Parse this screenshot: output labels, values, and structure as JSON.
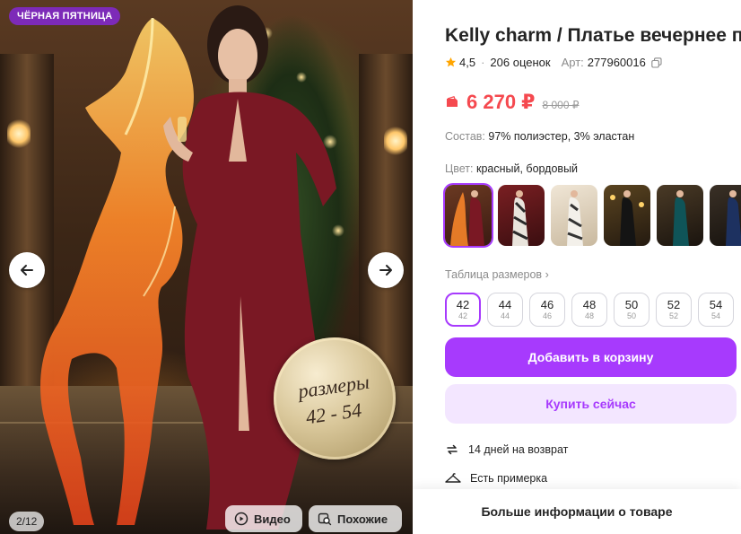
{
  "gallery": {
    "sale_badge": "ЧЁРНАЯ ПЯТНИЦА",
    "seal_line1": "размеры",
    "seal_line2": "42 - 54",
    "counter": "2/12",
    "video_label": "Видео",
    "similar_label": "Похожие",
    "prev_icon": "arrow-left-icon",
    "next_icon": "arrow-right-icon"
  },
  "product": {
    "title": "Kelly charm / Платье вечернее п",
    "rating": "4,5",
    "reviews": "206 оценок",
    "article_label": "Арт:",
    "article": "277960016",
    "price": "6 270 ₽",
    "old_price": "8 000 ₽",
    "composition_label": "Состав:",
    "composition": "97% полиэстер, 3% эластан",
    "color_label": "Цвет:",
    "color": "красный, бордовый"
  },
  "colors": [
    {
      "name": "thumb-1",
      "bg": "#5a1a1a"
    },
    {
      "name": "thumb-2",
      "bg": "#7a1f22"
    },
    {
      "name": "thumb-3",
      "bg": "#d9cbb5"
    },
    {
      "name": "thumb-4",
      "bg": "#2a2420"
    },
    {
      "name": "thumb-5",
      "bg": "#123c3e"
    },
    {
      "name": "thumb-6",
      "bg": "#1a2a4f"
    }
  ],
  "sizes_link": "Таблица размеров",
  "sizes": [
    {
      "big": "42",
      "small": "42"
    },
    {
      "big": "44",
      "small": "44"
    },
    {
      "big": "46",
      "small": "46"
    },
    {
      "big": "48",
      "small": "48"
    },
    {
      "big": "50",
      "small": "50"
    },
    {
      "big": "52",
      "small": "52"
    },
    {
      "big": "54",
      "small": "54"
    }
  ],
  "actions": {
    "add_to_cart": "Добавить в корзину",
    "buy_now": "Купить сейчас"
  },
  "perks": {
    "return": "14 дней на возврат",
    "fitting": "Есть примерка"
  },
  "more_info": "Больше информации о товаре",
  "theme": {
    "accent": "#a73afd",
    "price": "#f5494f"
  }
}
